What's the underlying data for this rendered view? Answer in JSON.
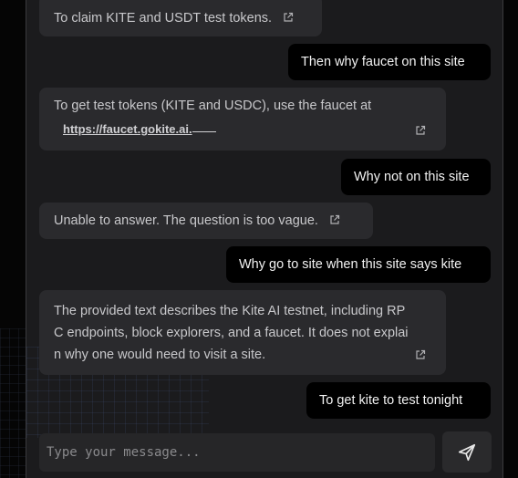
{
  "chat": {
    "messages": [
      {
        "role": "bot",
        "text": "To claim KITE and USDT test tokens."
      },
      {
        "role": "user",
        "text": "Then why faucet on this site"
      },
      {
        "role": "bot",
        "text": "To get test tokens (KITE and USDC), use the faucet at",
        "link": "https://faucet.gokite.ai."
      },
      {
        "role": "user",
        "text": "Why not on this site"
      },
      {
        "role": "bot",
        "text": "Unable to answer. The question is too vague."
      },
      {
        "role": "user",
        "text": "Why go to site when this site says kite"
      },
      {
        "role": "bot",
        "lines": [
          "The provided text describes the Kite AI testnet, including RP",
          "C endpoints, block explorers, and a faucet. It does not explai",
          "n why one would need to visit a site."
        ]
      },
      {
        "role": "user",
        "text": "To get kite to test tonight"
      }
    ]
  },
  "composer": {
    "placeholder": "Type your message..."
  },
  "icons": {
    "external_link": "external-link-icon",
    "send": "send-icon"
  }
}
